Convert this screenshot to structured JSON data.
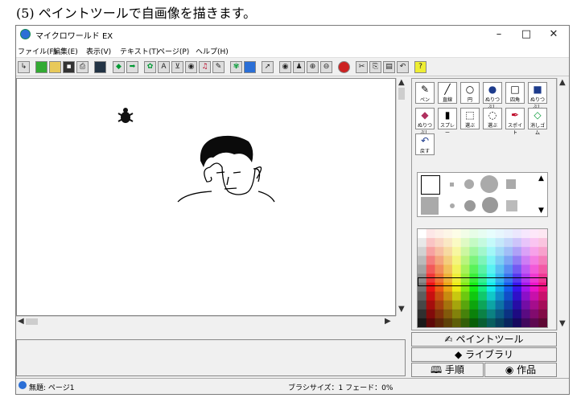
{
  "caption": "(5) ペイントツールで自画像を描きます。",
  "window": {
    "title": "マイクロワールド EX",
    "min": "–",
    "max": "□",
    "close": "✕"
  },
  "menu": [
    {
      "label": "ファイル(F)"
    },
    {
      "label": "編集(E)"
    },
    {
      "label": "表示(V)"
    },
    {
      "label": "テキスト(T)"
    },
    {
      "label": "ページ(P)"
    },
    {
      "label": "ヘルプ(H)"
    }
  ],
  "paint_tools": [
    {
      "label": "ペン",
      "icon": "✎"
    },
    {
      "label": "直線",
      "icon": "╱"
    },
    {
      "label": "円",
      "icon": "○"
    },
    {
      "label": "ぬりつぶし",
      "icon": "●"
    },
    {
      "label": "四角",
      "icon": "□"
    },
    {
      "label": "ぬりつぶし",
      "icon": "■"
    },
    {
      "label": "ぬりつぶし",
      "icon": "◆"
    },
    {
      "label": "スプレー",
      "icon": "▮"
    },
    {
      "label": "選ぶ",
      "icon": "⬚"
    },
    {
      "label": "選ぶ",
      "icon": "◌"
    },
    {
      "label": "スポイト",
      "icon": "✒"
    },
    {
      "label": "消しゴム",
      "icon": "◇"
    },
    {
      "label": "戻す",
      "icon": "↶"
    }
  ],
  "side_tabs": {
    "paint": "ペイントツール",
    "library": "ライブラリ",
    "procedure": "手順",
    "works": "作品"
  },
  "status": {
    "page": "無題: ページ1",
    "brush": "ブラシサイズ：1 フェード：0%"
  },
  "colors": {
    "accent": "#1e3c8c",
    "selection": "#000000"
  }
}
